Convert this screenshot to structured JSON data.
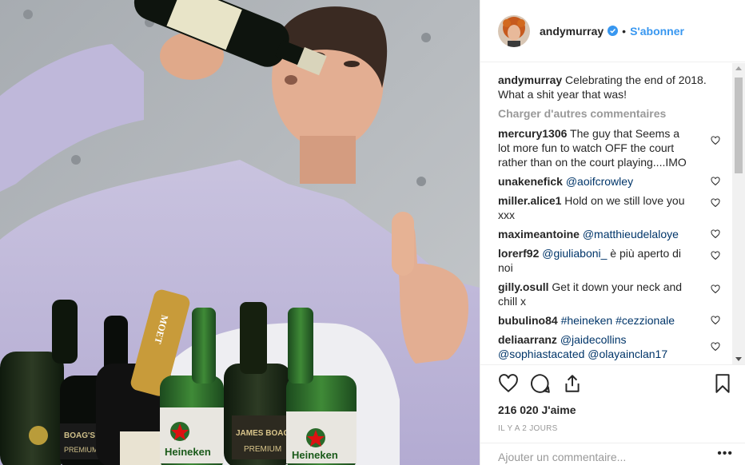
{
  "post": {
    "author": "andymurray",
    "follow_label": "S'abonner",
    "dot": "•",
    "caption_user": "andymurray",
    "caption_text": " Celebrating the end of 2018. What a shit year that was!",
    "load_more": "Charger d'autres commentaires",
    "likes": "216 020 J'aime",
    "time": "Il y a 2 jours",
    "add_comment_placeholder": "Ajouter un commentaire...",
    "more_label": "•••"
  },
  "comments": [
    {
      "user": "mercury1306",
      "text": " The guy that Seems a lot more fun to watch OFF the court rather than on the court playing....IMO"
    },
    {
      "user": "unakenefick",
      "mention": "@aoifcrowley"
    },
    {
      "user": "miller.alice1",
      "text": " Hold on we still love you xxx"
    },
    {
      "user": "maximeantoine",
      "mention": "@matthieudelaloye"
    },
    {
      "user": "lorerf92",
      "mention": "@giuliaboni_",
      "text": " è più aperto di noi"
    },
    {
      "user": "gilly.osull",
      "text": " Get it down your neck and chill x"
    },
    {
      "user": "bubulino84",
      "mention": "#heineken",
      "mention2": "#cezzionale"
    },
    {
      "user": "deliaarranz",
      "mention": "@jaidecollins",
      "mention2": "@sophiastacated",
      "mention3": "@olayainclan17"
    }
  ],
  "icons": [
    "heart-icon",
    "comment-icon",
    "share-icon",
    "bookmark-icon",
    "verified-badge-icon"
  ],
  "photo_labels": {
    "moet": "MOET",
    "heineken_1": "Heineken",
    "heineken_2": "Heineken",
    "james_boag": "JAMES BOAG'S",
    "premium": "PREMIUM",
    "boags": "BOAG'S",
    "premium_2": "PREMIUM"
  },
  "colors": {
    "link": "#3897f0",
    "mention": "#003569",
    "muted": "#999999",
    "verified": "#3897f0"
  }
}
